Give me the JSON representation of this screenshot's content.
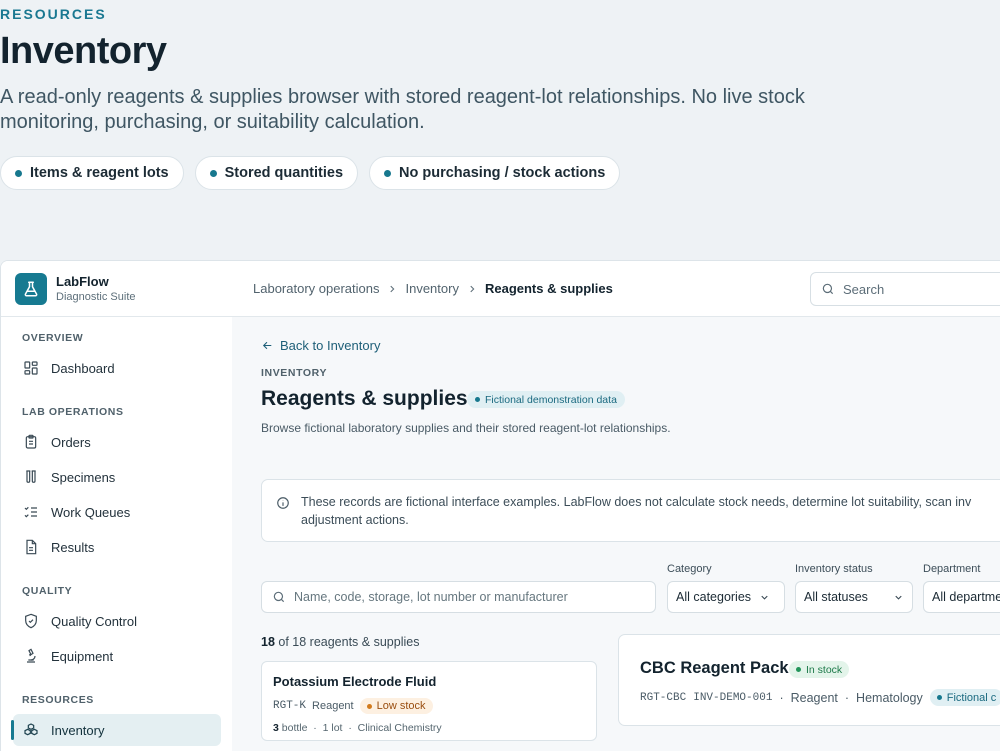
{
  "hero": {
    "eyebrow": "RESOURCES",
    "title": "Inventory",
    "description": "A read-only reagents & supplies browser with stored reagent-lot relationships. No live stock monitoring, purchasing, or suitability calculation.",
    "pills": [
      "Items & reagent lots",
      "Stored quantities",
      "No purchasing / stock actions"
    ]
  },
  "brand": {
    "name": "LabFlow",
    "subtitle": "Diagnostic Suite"
  },
  "sidebar": {
    "sections": [
      "OVERVIEW",
      "LAB OPERATIONS",
      "QUALITY",
      "RESOURCES"
    ],
    "items": [
      {
        "label": "Dashboard",
        "icon": "dashboard-icon"
      },
      {
        "label": "Orders",
        "icon": "clipboard-icon"
      },
      {
        "label": "Specimens",
        "icon": "test-tubes-icon"
      },
      {
        "label": "Work Queues",
        "icon": "list-checks-icon"
      },
      {
        "label": "Results",
        "icon": "document-icon"
      },
      {
        "label": "Quality Control",
        "icon": "shield-check-icon"
      },
      {
        "label": "Equipment",
        "icon": "microscope-icon"
      },
      {
        "label": "Inventory",
        "icon": "boxes-icon",
        "active": true
      }
    ]
  },
  "topbar": {
    "breadcrumbs": [
      "Laboratory operations",
      "Inventory",
      "Reagents & supplies"
    ],
    "search_placeholder": "Search"
  },
  "page": {
    "back_label": "Back to Inventory",
    "kicker": "INVENTORY",
    "title": "Reagents & supplies",
    "badge": "Fictional demonstration data",
    "description": "Browse fictional laboratory supplies and their stored reagent-lot relationships.",
    "notice_line1": "These records are fictional interface examples. LabFlow does not calculate stock needs, determine lot suitability, scan inv",
    "notice_line2": "adjustment actions."
  },
  "filters": {
    "search_placeholder": "Name, code, storage, lot number or manufacturer",
    "category": {
      "label": "Category",
      "value": "All categories"
    },
    "status": {
      "label": "Inventory status",
      "value": "All statuses"
    },
    "department": {
      "label": "Department",
      "value": "All departme"
    }
  },
  "results": {
    "shown": "18",
    "rest": "of 18 reagents & supplies"
  },
  "list": [
    {
      "name": "Potassium Electrode Fluid",
      "code": "RGT-K",
      "type": "Reagent",
      "status": "Low stock",
      "qty": "3",
      "unit": "bottle",
      "lots": "1 lot",
      "department": "Clinical Chemistry"
    }
  ],
  "detail": {
    "name": "CBC Reagent Pack",
    "status": "In stock",
    "code": "RGT-CBC",
    "inv": "INV-DEMO-001",
    "type": "Reagent",
    "department": "Hematology",
    "badge": "Fictional c"
  },
  "colors": {
    "accent": "#167a91",
    "low_stock": "#d27a1c",
    "in_stock": "#22955a"
  }
}
